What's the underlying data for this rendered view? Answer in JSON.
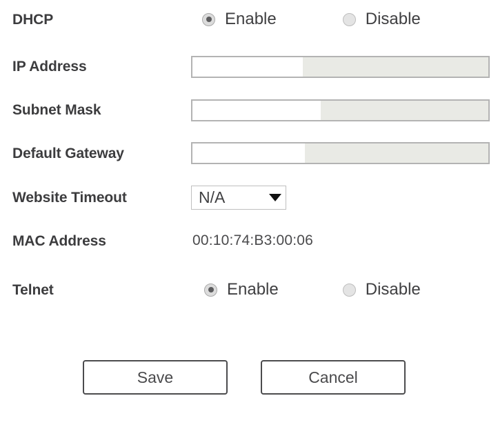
{
  "form": {
    "rows": [
      {
        "id": "dhcp",
        "label": "DHCP",
        "type": "radio",
        "options": [
          {
            "label": "Enable",
            "selected": true
          },
          {
            "label": "Disable",
            "selected": false
          }
        ]
      },
      {
        "id": "ip-address",
        "label": "IP Address",
        "type": "text",
        "value": "",
        "placeholder": ""
      },
      {
        "id": "subnet-mask",
        "label": "Subnet Mask",
        "type": "text",
        "value": "",
        "placeholder": ""
      },
      {
        "id": "default-gateway",
        "label": "Default Gateway",
        "type": "text",
        "value": "",
        "placeholder": ""
      },
      {
        "id": "website-timeout",
        "label": "Website Timeout",
        "type": "select",
        "value": "N/A",
        "icon": "chevron-down-icon"
      },
      {
        "id": "mac-address",
        "label": "MAC Address",
        "type": "static",
        "value": "00:10:74:B3:00:06"
      },
      {
        "id": "telnet",
        "label": "Telnet",
        "type": "radio",
        "options": [
          {
            "label": "Enable",
            "selected": true
          },
          {
            "label": "Disable",
            "selected": false
          }
        ]
      }
    ]
  },
  "actions": {
    "save_label": "Save",
    "cancel_label": "Cancel"
  },
  "colors": {
    "background": "#ffffff",
    "label_text": "#3c3c3e",
    "value_text": "#4a4a4c",
    "field_border": "#b3b3b3",
    "field_disabled_fill": "#e9eae5",
    "field_fill": "#ffffff",
    "radio_dot": "#5c5c5e",
    "button_border": "#4b4b4d"
  }
}
